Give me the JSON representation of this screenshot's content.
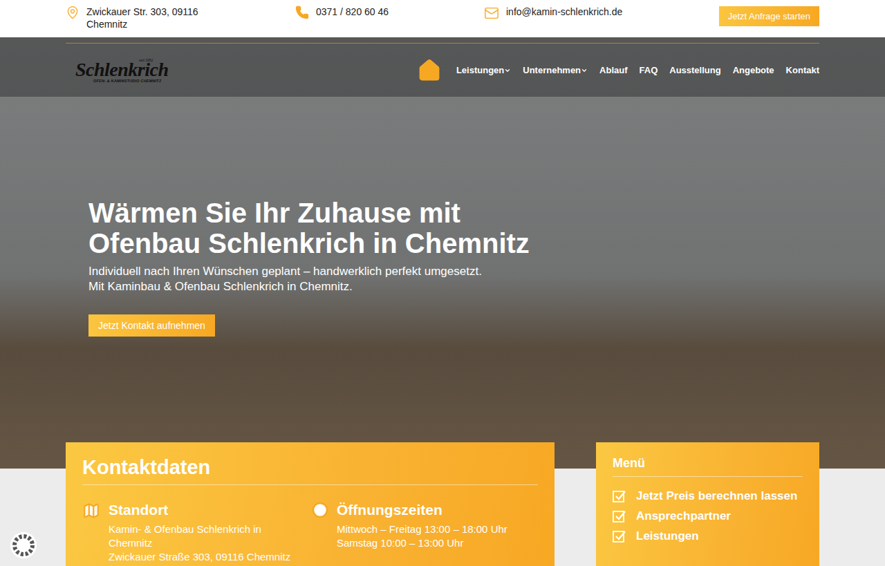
{
  "topbar": {
    "address": [
      "Zwickauer Str. 303, 09116",
      "Chemnitz"
    ],
    "phone": "0371 / 820 60 46",
    "email": "info@kamin-schlenkrich.de",
    "cta": "Jetzt Anfrage starten"
  },
  "logo": {
    "since": "seit 1952",
    "name": "Schlenkrich",
    "tagline": "OFEN- & KAMINSTUDIO CHEMNITZ"
  },
  "nav": {
    "home_selected": true,
    "items": [
      {
        "label": "Leistungen",
        "dropdown": true,
        "selected": false
      },
      {
        "label": "Unternehmen",
        "dropdown": true,
        "selected": false
      },
      {
        "label": "Ablauf",
        "dropdown": false,
        "selected": false
      },
      {
        "label": "FAQ",
        "dropdown": false,
        "selected": false
      },
      {
        "label": "Ausstellung",
        "dropdown": false,
        "selected": false
      },
      {
        "label": "Angebote",
        "dropdown": false,
        "selected": false
      },
      {
        "label": "Kontakt",
        "dropdown": false,
        "selected": false
      }
    ]
  },
  "hero": {
    "title": [
      "Wärmen Sie Ihr Zuhause mit",
      "Ofenbau Schlenkrich in Chemnitz"
    ],
    "subtitle": [
      "Individuell nach Ihren Wünschen geplant – handwerklich perfekt umgesetzt.",
      "Mit Kaminbau & Ofenbau Schlenkrich in Chemnitz."
    ],
    "button": "Jetzt Kontakt aufnehmen"
  },
  "contact": {
    "title": "Kontaktdaten",
    "columns": [
      {
        "kind": "location",
        "heading": "Standort",
        "lines": [
          "Kamin- & Ofenbau Schlenkrich in",
          "Chemnitz",
          "Zwickauer Straße 303, 09116 Chemnitz"
        ]
      },
      {
        "kind": "hours",
        "heading": "Öffnungszeiten",
        "lines": [
          "Mittwoch – Freitag 13:00 – 18:00 Uhr",
          "Samstag 10:00 – 13:00 Uhr"
        ]
      }
    ]
  },
  "menu": {
    "title": "Menü",
    "items": [
      {
        "label": "Jetzt Preis berechnen lassen",
        "checked": true
      },
      {
        "label": "Ansprechpartner",
        "checked": true
      },
      {
        "label": "Leistungen",
        "checked": true
      }
    ]
  }
}
